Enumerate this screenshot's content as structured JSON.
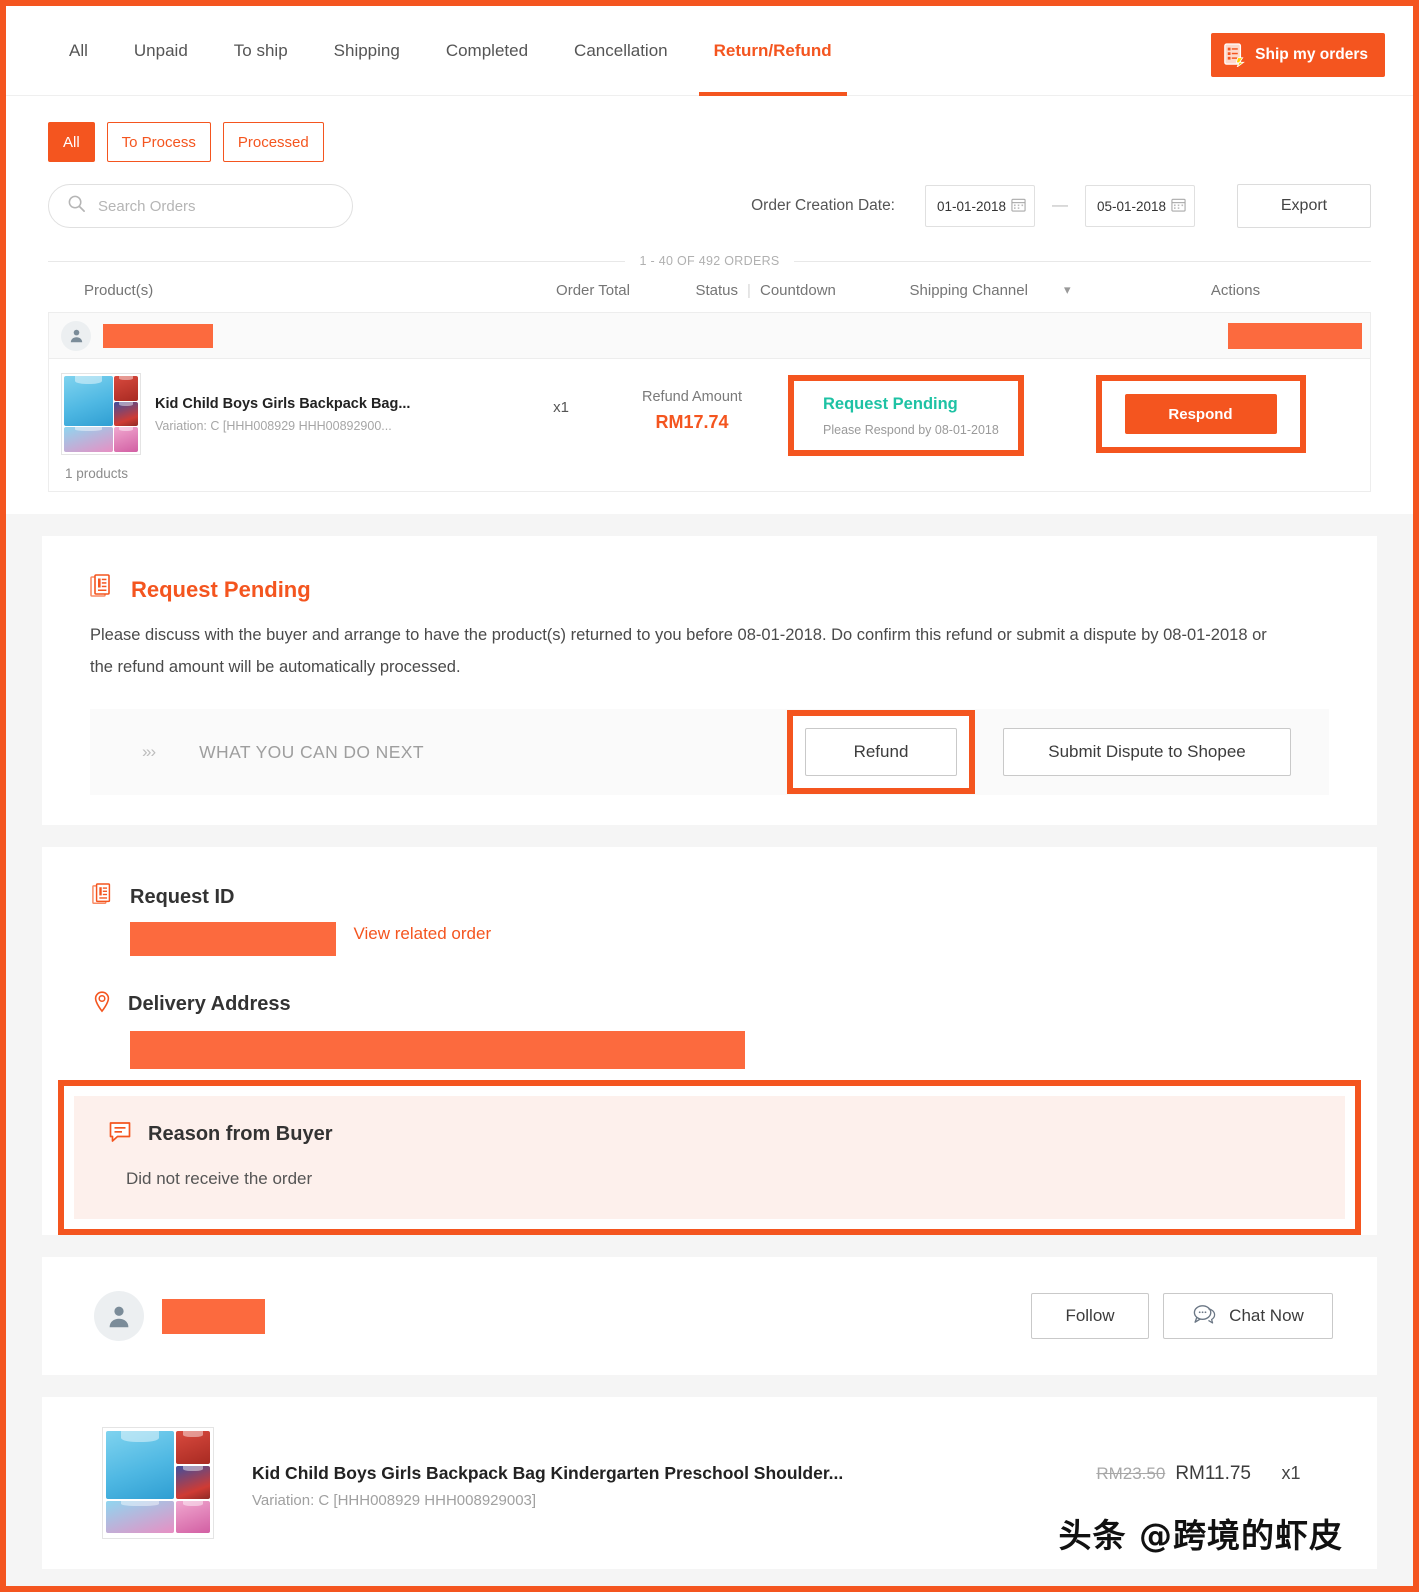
{
  "top_nav": {
    "tabs": [
      {
        "label": "All",
        "active": false
      },
      {
        "label": "Unpaid",
        "active": false
      },
      {
        "label": "To ship",
        "active": false
      },
      {
        "label": "Shipping",
        "active": false
      },
      {
        "label": "Completed",
        "active": false
      },
      {
        "label": "Cancellation",
        "active": false
      },
      {
        "label": "Return/Refund",
        "active": true
      }
    ],
    "ship_button": "Ship my orders",
    "accent_color": "#f4551f"
  },
  "filters": {
    "chips": [
      {
        "label": "All",
        "active": true
      },
      {
        "label": "To Process",
        "active": false
      },
      {
        "label": "Processed",
        "active": false
      }
    ],
    "search_placeholder": "Search Orders",
    "search_value": "",
    "date_label": "Order Creation Date:",
    "date_from": "01-01-2018",
    "date_to": "05-01-2018",
    "date_separator": "—",
    "export_label": "Export",
    "count_text": "1 - 40 OF 492 ORDERS"
  },
  "table": {
    "headers": {
      "product": "Product(s)",
      "order_total": "Order Total",
      "status": "Status",
      "separator": "|",
      "countdown": "Countdown",
      "shipping_channel": "Shipping Channel",
      "actions": "Actions"
    },
    "order": {
      "buyer_name_redacted": true,
      "request_id_label": "Request ID",
      "request_id_redacted": true,
      "product_name": "Kid Child Boys Girls Backpack Bag...",
      "product_variation": "Variation: C [HHH008929 HHH00892900...",
      "product_count": "1 products",
      "quantity": "x1",
      "refund_label": "Refund Amount",
      "refund_amount": "RM17.74",
      "status_title": "Request Pending",
      "status_sub": "Please Respond by 08-01-2018",
      "status_color": "#1ec2a4",
      "action_button": "Respond"
    }
  },
  "pending_panel": {
    "title": "Request Pending",
    "description": "Please discuss with the buyer and arrange to have the product(s) returned to you before 08-01-2018. Do confirm this refund or submit a dispute by 08-01-2018 or the refund amount will be automatically processed.",
    "next_chevrons": "≫",
    "next_label": "WHAT YOU CAN DO NEXT",
    "refund_button": "Refund",
    "dispute_button": "Submit Dispute to Shopee"
  },
  "info_panel": {
    "request_id_title": "Request ID",
    "request_id_redacted": true,
    "view_related_order": "View related order",
    "delivery_address_title": "Delivery Address",
    "delivery_address_redacted": true,
    "reason_title": "Reason from Buyer",
    "reason_text": "Did not receive the order"
  },
  "buyer_panel": {
    "name_redacted": true,
    "follow_button": "Follow",
    "chat_button": "Chat Now"
  },
  "product_panel": {
    "name": "Kid Child Boys Girls Backpack Bag Kindergarten Preschool Shoulder...",
    "variation": "Variation: C [HHH008929 HHH008929003]",
    "price_original": "RM23.50",
    "price_current": "RM11.75",
    "quantity": "x1"
  },
  "watermark": "头条 @跨境的虾皮"
}
